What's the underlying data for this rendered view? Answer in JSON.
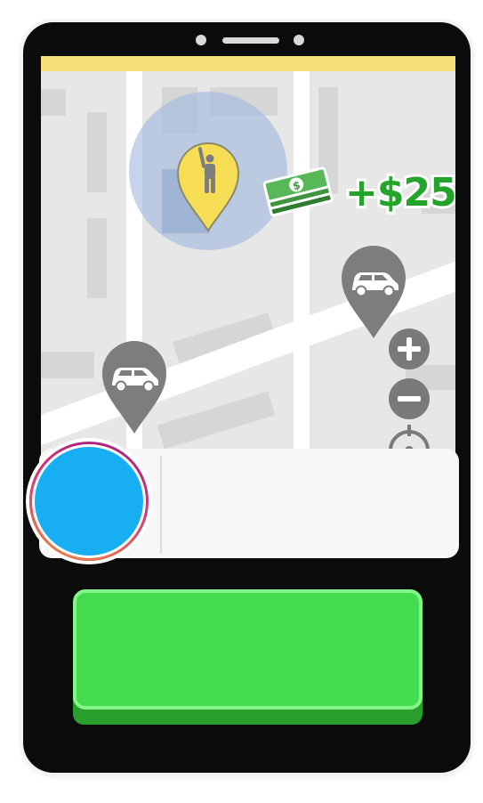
{
  "app": {
    "colors": {
      "status_bar": "#f7e07a",
      "map_bg": "#e7e7e7",
      "pickup_pin": "#f6dd55",
      "car_pin": "#7d7d7d",
      "bonus_text": "#22a52a",
      "avatar_fill": "#18aef2",
      "action_button": "#44dc4c"
    }
  },
  "map": {
    "pickup_pin_icon": "person-waving-icon",
    "car_pin_icon": "car-icon",
    "bonus": {
      "icon": "cash-stack-icon",
      "text": "+$25"
    },
    "controls": {
      "zoom_in_icon": "plus-icon",
      "zoom_out_icon": "minus-icon",
      "locate_icon": "crosshair-icon"
    }
  },
  "driver_card": {
    "avatar_icon": "avatar",
    "text": ""
  },
  "action_button": {
    "label": ""
  }
}
